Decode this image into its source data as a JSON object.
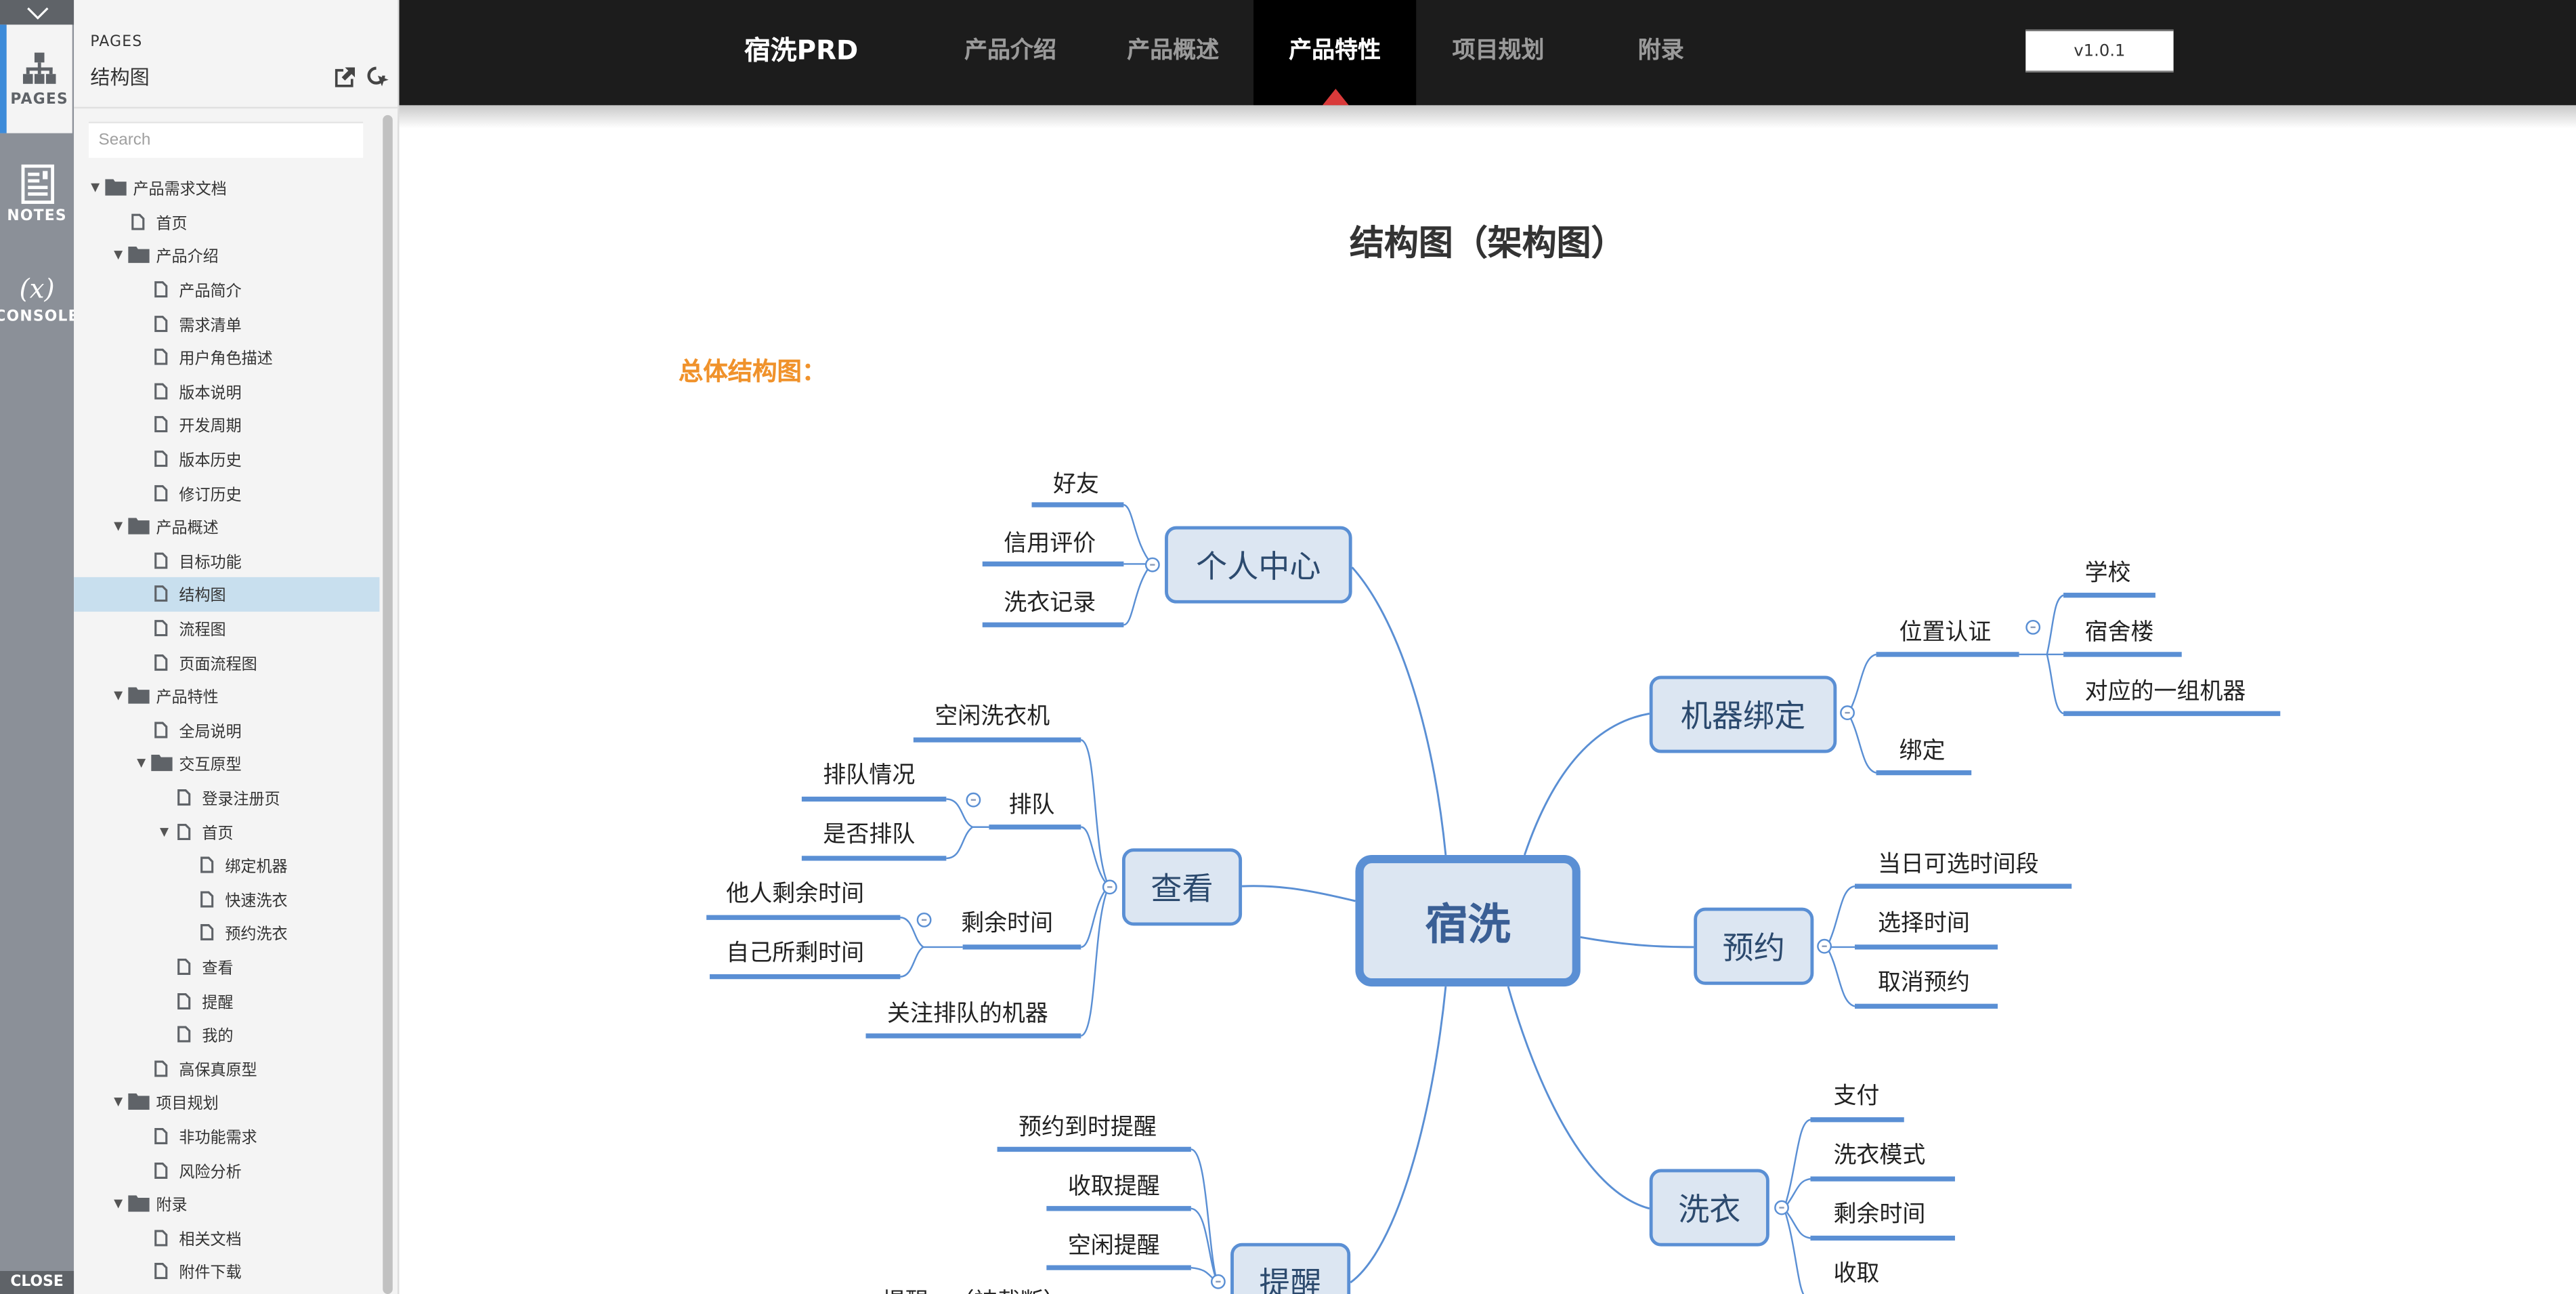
{
  "rail": {
    "collapse_icon": "chevron-down-icon",
    "tabs": [
      {
        "label": "PAGES",
        "icon": "sitemap-icon",
        "active": true
      },
      {
        "label": "NOTES",
        "icon": "notes-icon",
        "active": false
      },
      {
        "label": "CONSOLE",
        "icon": "variable-x-icon",
        "active": false
      }
    ],
    "close_label": "CLOSE"
  },
  "panel": {
    "caption": "PAGES",
    "current_page": "结构图",
    "export_icon": "external-link-icon",
    "locate_icon": "locate-cursor-icon",
    "search_placeholder": "Search",
    "tree": [
      {
        "label": "产品需求文档",
        "type": "folder",
        "depth": 0,
        "expanded": true
      },
      {
        "label": "首页",
        "type": "page",
        "depth": 1
      },
      {
        "label": "产品介绍",
        "type": "folder",
        "depth": 1,
        "expanded": true
      },
      {
        "label": "产品简介",
        "type": "page",
        "depth": 2
      },
      {
        "label": "需求清单",
        "type": "page",
        "depth": 2
      },
      {
        "label": "用户角色描述",
        "type": "page",
        "depth": 2
      },
      {
        "label": "版本说明",
        "type": "page",
        "depth": 2
      },
      {
        "label": "开发周期",
        "type": "page",
        "depth": 2
      },
      {
        "label": "版本历史",
        "type": "page",
        "depth": 2
      },
      {
        "label": "修订历史",
        "type": "page",
        "depth": 2
      },
      {
        "label": "产品概述",
        "type": "folder",
        "depth": 1,
        "expanded": true
      },
      {
        "label": "目标功能",
        "type": "page",
        "depth": 2
      },
      {
        "label": "结构图",
        "type": "page",
        "depth": 2,
        "selected": true
      },
      {
        "label": "流程图",
        "type": "page",
        "depth": 2
      },
      {
        "label": "页面流程图",
        "type": "page",
        "depth": 2
      },
      {
        "label": "产品特性",
        "type": "folder",
        "depth": 1,
        "expanded": true
      },
      {
        "label": "全局说明",
        "type": "page",
        "depth": 2
      },
      {
        "label": "交互原型",
        "type": "folder",
        "depth": 2,
        "expanded": true
      },
      {
        "label": "登录注册页",
        "type": "page",
        "depth": 3
      },
      {
        "label": "首页",
        "type": "page",
        "depth": 3,
        "expanded": true
      },
      {
        "label": "绑定机器",
        "type": "page",
        "depth": 4
      },
      {
        "label": "快速洗衣",
        "type": "page",
        "depth": 4
      },
      {
        "label": "预约洗衣",
        "type": "page",
        "depth": 4
      },
      {
        "label": "查看",
        "type": "page",
        "depth": 3
      },
      {
        "label": "提醒",
        "type": "page",
        "depth": 3
      },
      {
        "label": "我的",
        "type": "page",
        "depth": 3
      },
      {
        "label": "高保真原型",
        "type": "page",
        "depth": 2
      },
      {
        "label": "项目规划",
        "type": "folder",
        "depth": 1,
        "expanded": true
      },
      {
        "label": "非功能需求",
        "type": "page",
        "depth": 2
      },
      {
        "label": "风险分析",
        "type": "page",
        "depth": 2
      },
      {
        "label": "附录",
        "type": "folder",
        "depth": 1,
        "expanded": true
      },
      {
        "label": "相关文档",
        "type": "page",
        "depth": 2
      },
      {
        "label": "附件下载",
        "type": "page",
        "depth": 2
      }
    ]
  },
  "topnav": {
    "brand": "宿洗PRD",
    "items": [
      {
        "label": "产品介绍",
        "active": false
      },
      {
        "label": "产品概述",
        "active": false
      },
      {
        "label": "产品特性",
        "active": true
      },
      {
        "label": "项目规划",
        "active": false
      },
      {
        "label": "附录",
        "active": false
      }
    ],
    "version": "v1.0.1",
    "active_indicator_color": "#d93a3a"
  },
  "content": {
    "title": "结构图（架构图）",
    "section_label": "总体结构图："
  },
  "mindmap": {
    "root": "宿洗",
    "branches": [
      {
        "label": "个人中心",
        "side": "left",
        "children": [
          {
            "label": "好友"
          },
          {
            "label": "信用评价"
          },
          {
            "label": "洗衣记录"
          }
        ]
      },
      {
        "label": "查看",
        "side": "left",
        "children": [
          {
            "label": "空闲洗衣机"
          },
          {
            "label": "排队",
            "children": [
              {
                "label": "排队情况"
              },
              {
                "label": "是否排队"
              }
            ]
          },
          {
            "label": "剩余时间",
            "children": [
              {
                "label": "他人剩余时间"
              },
              {
                "label": "自己所剩时间"
              }
            ]
          },
          {
            "label": "关注排队的机器"
          }
        ]
      },
      {
        "label": "提醒",
        "side": "left",
        "children": [
          {
            "label": "预约到时提醒"
          },
          {
            "label": "收取提醒"
          },
          {
            "label": "空闲提醒"
          },
          {
            "label": "提醒…（被截断）"
          }
        ]
      },
      {
        "label": "机器绑定",
        "side": "right",
        "children": [
          {
            "label": "位置认证",
            "children": [
              {
                "label": "学校"
              },
              {
                "label": "宿舍楼"
              },
              {
                "label": "对应的一组机器"
              }
            ]
          },
          {
            "label": "绑定"
          }
        ]
      },
      {
        "label": "预约",
        "side": "right",
        "children": [
          {
            "label": "当日可选时间段"
          },
          {
            "label": "选择时间"
          },
          {
            "label": "取消预约"
          }
        ]
      },
      {
        "label": "洗衣",
        "side": "right",
        "children": [
          {
            "label": "支付"
          },
          {
            "label": "洗衣模式"
          },
          {
            "label": "剩余时间"
          },
          {
            "label": "收取"
          }
        ]
      }
    ],
    "colors": {
      "line": "#5a8fd4",
      "node_fill": "#dce6f2",
      "node_text": "#2c4a6e"
    }
  }
}
